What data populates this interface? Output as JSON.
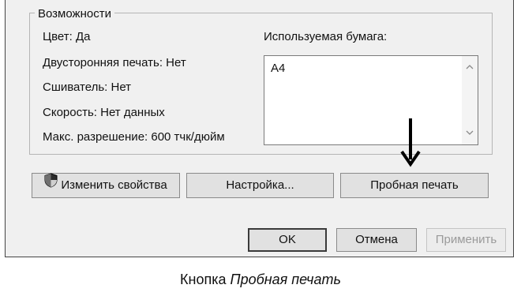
{
  "group": {
    "title": "Возможности"
  },
  "features": {
    "color": "Цвет: Да",
    "duplex": "Двусторонняя печать: Нет",
    "stapler": "Сшиватель: Нет",
    "speed": "Скорость: Нет данных",
    "max_resolution": "Макс. разрешение: 600 тчк/дюйм"
  },
  "paper": {
    "label": "Используемая бумага:",
    "items": [
      "A4"
    ]
  },
  "buttons": {
    "change_properties": "Изменить свойства",
    "setup": "Настройка...",
    "test_print": "Пробная печать"
  },
  "footer": {
    "ok": "OK",
    "cancel": "Отмена",
    "apply": "Применить"
  },
  "caption": {
    "prefix": "Кнопка",
    "emphasis": "Пробная печать"
  },
  "icons": {
    "shield": "uac-shield-icon",
    "arrow": "arrow-down-icon"
  }
}
